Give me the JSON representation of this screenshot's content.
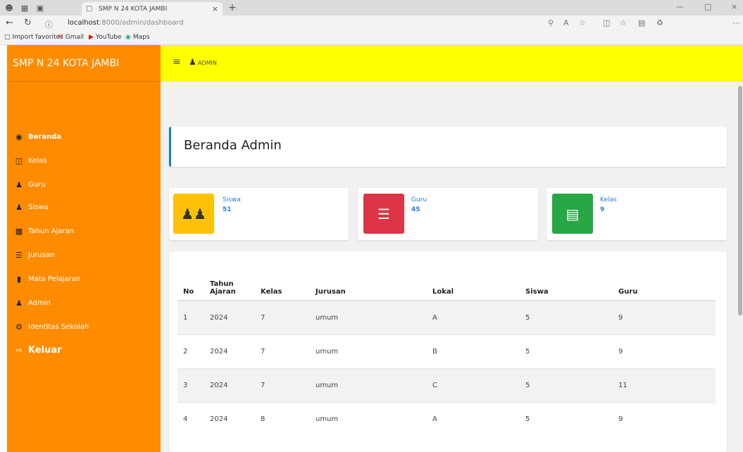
{
  "browser": {
    "tab_title": "SMP N 24 KOTA JAMBI",
    "url_host": "localhost",
    "url_path": ":8000/admin/dashboard",
    "favorites": [
      {
        "label": "Import favorites",
        "icon": "folder-icon"
      },
      {
        "label": "Gmail",
        "icon": "gmail-icon"
      },
      {
        "label": "YouTube",
        "icon": "youtube-icon"
      },
      {
        "label": "Maps",
        "icon": "maps-icon"
      }
    ]
  },
  "sidebar": {
    "brand": "SMP N 24 KOTA JAMBI",
    "items": [
      {
        "label": "Beranda",
        "icon": "dashboard-icon"
      },
      {
        "label": "Kelas",
        "icon": "class-icon"
      },
      {
        "label": "Guru",
        "icon": "user-icon"
      },
      {
        "label": "Siswa",
        "icon": "user-icon"
      },
      {
        "label": "Tahun Ajaran",
        "icon": "calendar-icon"
      },
      {
        "label": "Jurusan",
        "icon": "list-icon"
      },
      {
        "label": "Mata Pelajaran",
        "icon": "book-icon"
      },
      {
        "label": "Admin",
        "icon": "user-icon"
      },
      {
        "label": "Identitas Sekolah",
        "icon": "gear-icon"
      },
      {
        "label": "Keluar",
        "icon": "logout-icon"
      }
    ]
  },
  "topbar": {
    "user": "ADMIN"
  },
  "page": {
    "title": "Beranda Admin"
  },
  "stats": [
    {
      "label": "Siswa",
      "value": "51",
      "color": "#ffc107",
      "icon": "users-icon"
    },
    {
      "label": "Guru",
      "value": "45",
      "color": "#dc3545",
      "icon": "list-icon"
    },
    {
      "label": "Kelas",
      "value": "9",
      "color": "#28a745",
      "icon": "document-icon"
    }
  ],
  "table": {
    "headers": [
      "No",
      "Tahun Ajaran",
      "Kelas",
      "Jurusan",
      "Lokal",
      "Siswa",
      "Guru"
    ],
    "rows": [
      [
        "1",
        "2024",
        "7",
        "umum",
        "A",
        "5",
        "9"
      ],
      [
        "2",
        "2024",
        "7",
        "umum",
        "B",
        "5",
        "9"
      ],
      [
        "3",
        "2024",
        "7",
        "umum",
        "C",
        "5",
        "11"
      ],
      [
        "4",
        "2024",
        "8",
        "umum",
        "A",
        "5",
        "9"
      ]
    ]
  }
}
